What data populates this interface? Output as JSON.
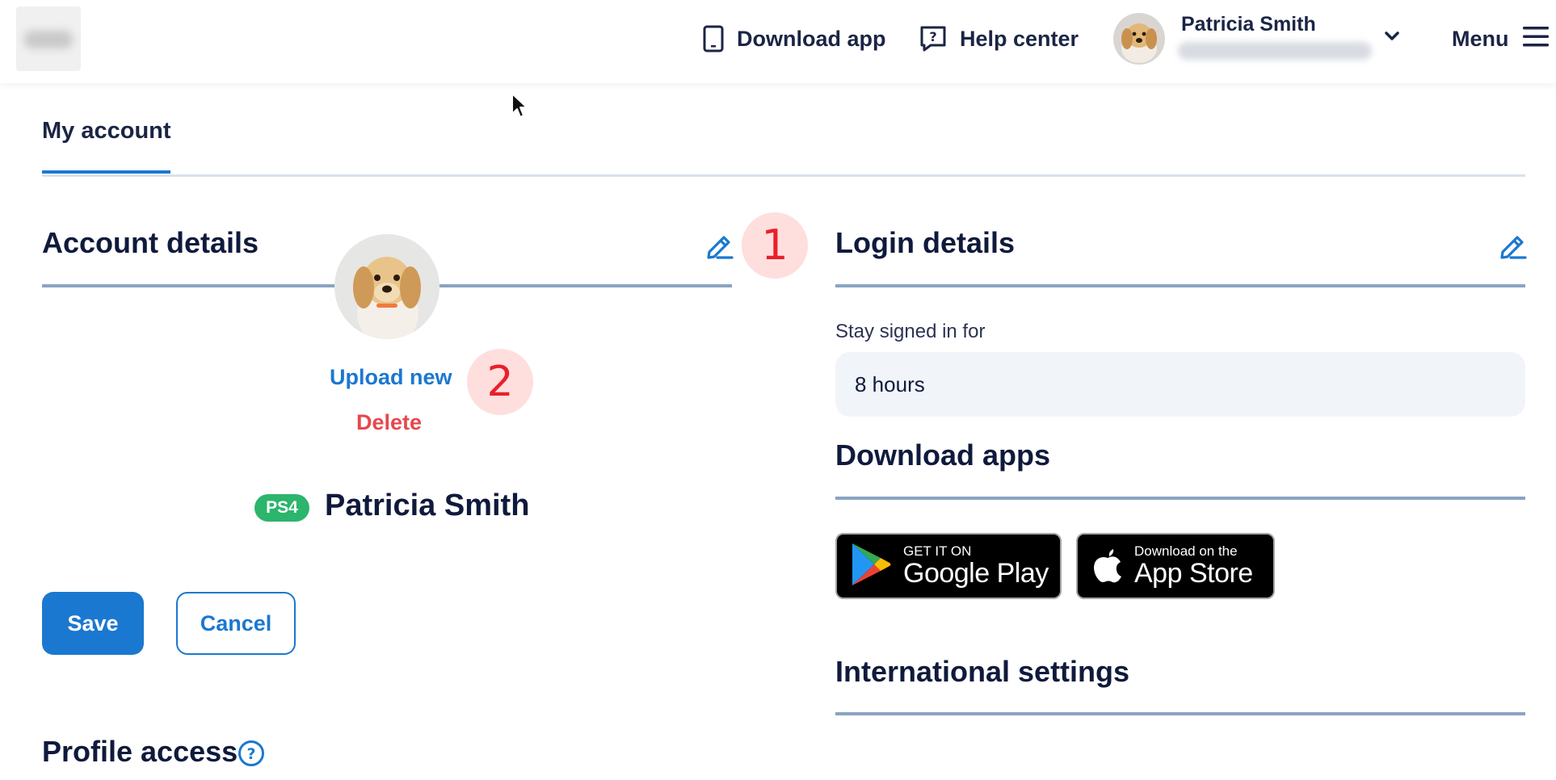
{
  "header": {
    "download_app_label": "Download app",
    "help_center_label": "Help center",
    "user_name": "Patricia Smith",
    "menu_label": "Menu"
  },
  "tabs": [
    {
      "label": "My account",
      "active": true
    }
  ],
  "account_details": {
    "title": "Account details",
    "upload_label": "Upload new",
    "delete_label": "Delete",
    "initials": "PS4",
    "full_name": "Patricia Smith",
    "save_label": "Save",
    "cancel_label": "Cancel"
  },
  "profile_access": {
    "title": "Profile access"
  },
  "login_details": {
    "title": "Login details",
    "stay_signed_in_label": "Stay signed in for",
    "stay_signed_in_value": "8 hours"
  },
  "download_apps": {
    "title": "Download apps",
    "google_play": {
      "small": "GET IT ON",
      "big": "Google Play"
    },
    "app_store": {
      "small": "Download on the",
      "big": "App Store"
    }
  },
  "international_settings": {
    "title": "International settings"
  },
  "annotations": {
    "badge_1": "1",
    "badge_2": "2"
  },
  "colors": {
    "accent": "#1b78d0",
    "danger": "#e5484d",
    "initials_badge": "#2cb56c",
    "annotation_bg": "#ffdede",
    "annotation_text": "#e8202a"
  },
  "icons": [
    "device-icon",
    "help-chat-icon",
    "chevron-down-icon",
    "hamburger-icon",
    "pencil-icon",
    "question-circle-icon",
    "google-play-icon",
    "apple-icon",
    "cursor-icon"
  ]
}
